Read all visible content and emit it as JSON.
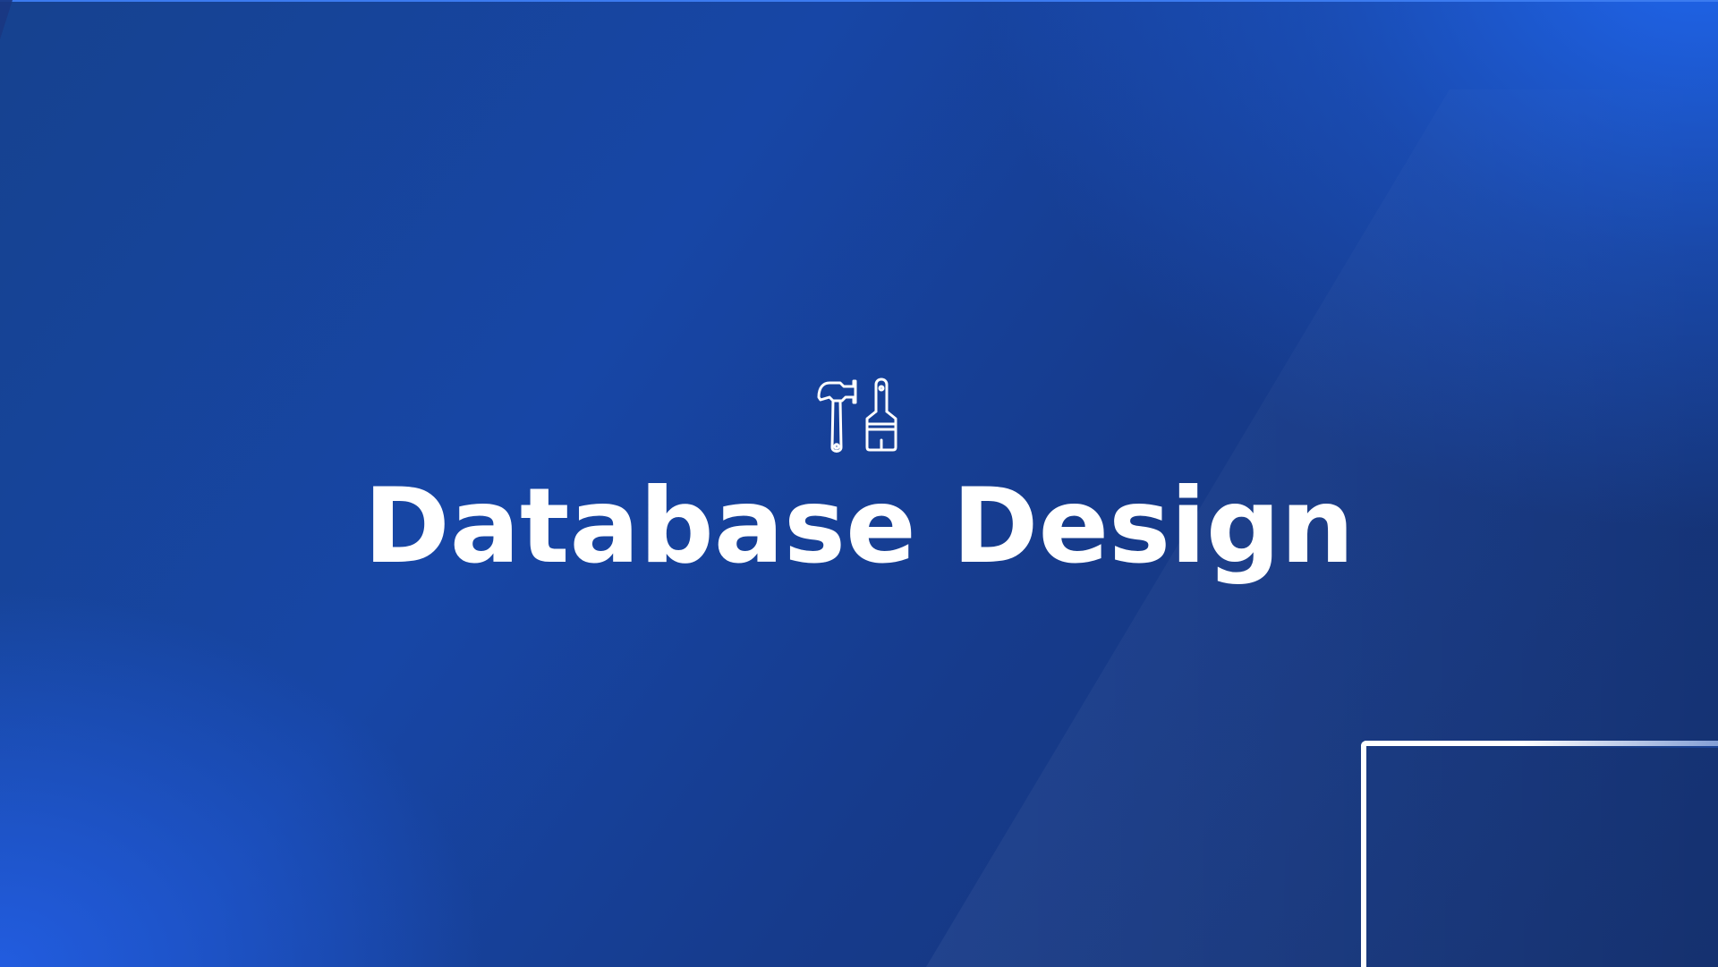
{
  "slide": {
    "title": "Database Design",
    "icon": "hammer-and-paintbrush-icon",
    "colors": {
      "background_dark": "#15316f",
      "background_mid": "#1746a6",
      "accent_glow": "#2069f5",
      "text": "#ffffff"
    }
  }
}
